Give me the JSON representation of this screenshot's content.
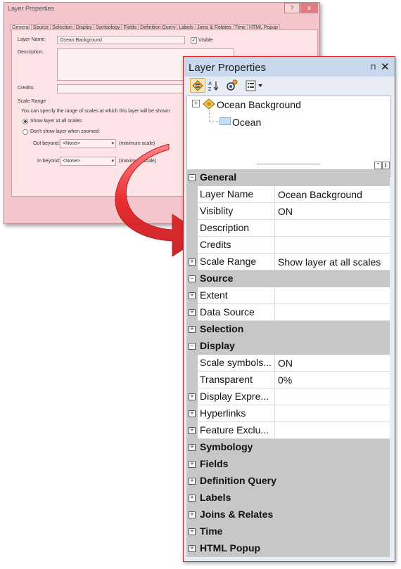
{
  "old_dialog": {
    "title": "Layer Properties",
    "help": "?",
    "close": "x",
    "tabs": [
      "General",
      "Source",
      "Selection",
      "Display",
      "Symbology",
      "Fields",
      "Definition Query",
      "Labels",
      "Joins & Relates",
      "Time",
      "HTML Popup"
    ],
    "layer_name_label": "Layer Name:",
    "layer_name_value": "Ocean Background",
    "visible_label": "Visible",
    "description_label": "Description:",
    "credits_label": "Credits:",
    "scale_range_heading": "Scale Range",
    "scale_hint": "You can specify the range of scales at which this layer will be shown:",
    "radio_show_all": "Show layer at all scales",
    "radio_dont_show": "Don't show layer when zoomed:",
    "out_beyond_label": "Out beyond:",
    "out_beyond_value": "<None>",
    "out_beyond_note": "(minimum scale)",
    "in_beyond_label": "In beyond:",
    "in_beyond_value": "<None>",
    "in_beyond_note": "(maximum scale)"
  },
  "panel": {
    "title": "Layer Properties",
    "pin": "⊓",
    "close": "✕",
    "tree": {
      "root": "Ocean Background",
      "child": "Ocean",
      "expander": "+"
    },
    "splitter": {
      "collapse": "⌃",
      "info": "i"
    },
    "grid": [
      {
        "type": "cat",
        "label": "General",
        "exp": "−"
      },
      {
        "type": "prop",
        "name": "Layer Name",
        "value": "Ocean Background"
      },
      {
        "type": "prop",
        "name": "Visiblity",
        "value": "ON"
      },
      {
        "type": "prop",
        "name": "Description",
        "value": ""
      },
      {
        "type": "prop",
        "name": "Credits",
        "value": ""
      },
      {
        "type": "prop",
        "name": "Scale Range",
        "value": "Show layer at all scales",
        "exp": "+"
      },
      {
        "type": "cat",
        "label": "Source",
        "exp": "−"
      },
      {
        "type": "prop",
        "name": "Extent",
        "value": "",
        "exp": "+"
      },
      {
        "type": "prop",
        "name": "Data Source",
        "value": "",
        "exp": "+"
      },
      {
        "type": "cat",
        "label": "Selection",
        "exp": "+"
      },
      {
        "type": "cat",
        "label": "Display",
        "exp": "−"
      },
      {
        "type": "prop",
        "name": "Scale symbols...",
        "value": "ON"
      },
      {
        "type": "prop",
        "name": "Transparent",
        "value": "0%"
      },
      {
        "type": "prop",
        "name": "Display Expre...",
        "value": "",
        "exp": "+"
      },
      {
        "type": "prop",
        "name": "Hyperlinks",
        "value": "",
        "exp": "+"
      },
      {
        "type": "prop",
        "name": "Feature Exclu...",
        "value": "",
        "exp": "+"
      },
      {
        "type": "cat",
        "label": "Symbology",
        "exp": "+"
      },
      {
        "type": "cat",
        "label": "Fields",
        "exp": "+"
      },
      {
        "type": "cat",
        "label": "Definition Query",
        "exp": "+"
      },
      {
        "type": "cat",
        "label": "Labels",
        "exp": "+"
      },
      {
        "type": "cat",
        "label": "Joins & Relates",
        "exp": "+"
      },
      {
        "type": "cat",
        "label": "Time",
        "exp": "+"
      },
      {
        "type": "cat",
        "label": "HTML Popup",
        "exp": "+"
      }
    ]
  },
  "colors": {
    "old_dialog_bg": "#f4c6cb",
    "arrow_red": "#e8262a",
    "panel_border": "#dd2222",
    "category_gray": "#c7c7c7",
    "title_bar": "#c8d9ee"
  }
}
